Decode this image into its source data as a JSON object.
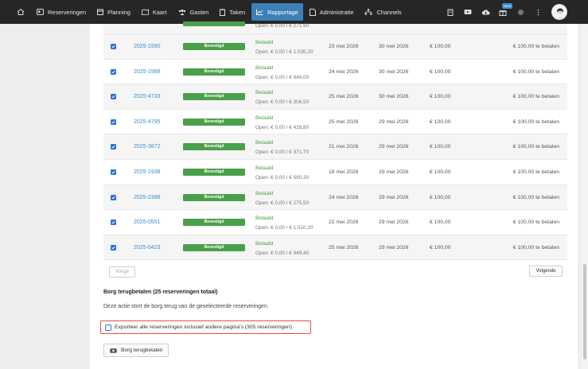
{
  "nav": {
    "items": [
      {
        "label": "Reserveringen",
        "icon": "calendar-card-icon"
      },
      {
        "label": "Planning",
        "icon": "calendar-icon"
      },
      {
        "label": "Kaart",
        "icon": "map-icon"
      },
      {
        "label": "Gasten",
        "icon": "users-icon"
      },
      {
        "label": "Taken",
        "icon": "clipboard-icon"
      },
      {
        "label": "Rapportage",
        "icon": "chart-icon",
        "active": true
      },
      {
        "label": "Administratie",
        "icon": "document-icon"
      },
      {
        "label": "Channels",
        "icon": "sitemap-icon"
      }
    ],
    "badge_new": "NEW"
  },
  "rows": [
    {
      "id": "2025-1990",
      "status": "Bevestigd",
      "payment": "Betaald",
      "open": "Open: € 0,00 / € 1.035,20",
      "arrival": "23 mei 2026",
      "departure": "30 mei 2026",
      "deposit": "€ 100,00",
      "due": "€ 100,00 te betalen"
    },
    {
      "id": "2025-1988",
      "status": "Bevestigd",
      "payment": "Betaald",
      "open": "Open: € 0,00 / € 946,00",
      "arrival": "24 mei 2026",
      "departure": "30 mei 2026",
      "deposit": "€ 100,00",
      "due": "€ 100,00 te betalen"
    },
    {
      "id": "2025-4733",
      "status": "Bevestigd",
      "payment": "Betaald",
      "open": "Open: € 0,00 / € 306,50",
      "arrival": "25 mei 2026",
      "departure": "30 mei 2026",
      "deposit": "€ 100,00",
      "due": "€ 100,00 te betalen"
    },
    {
      "id": "2025-4795",
      "status": "Bevestigd",
      "payment": "Betaald",
      "open": "Open: € 0,00 / € 428,80",
      "arrival": "25 mei 2026",
      "departure": "29 mei 2026",
      "deposit": "€ 100,00",
      "due": "€ 100,00 te betalen"
    },
    {
      "id": "2025-3872",
      "status": "Bevestigd",
      "payment": "Betaald",
      "open": "Open: € 0,00 / € 371,70",
      "arrival": "21 mei 2026",
      "departure": "29 mei 2026",
      "deposit": "€ 100,00",
      "due": "€ 100,00 te betalen"
    },
    {
      "id": "2025-1938",
      "status": "Bevestigd",
      "payment": "Betaald",
      "open": "Open: € 0,00 / € 560,30",
      "arrival": "18 mei 2026",
      "departure": "29 mei 2026",
      "deposit": "€ 100,00",
      "due": "€ 100,00 te betalen"
    },
    {
      "id": "2025-2388",
      "status": "Bevestigd",
      "payment": "Betaald",
      "open": "Open: € 0,00 / € 275,50",
      "arrival": "24 mei 2026",
      "departure": "29 mei 2026",
      "deposit": "€ 100,00",
      "due": "€ 100,00 te betalen"
    },
    {
      "id": "2025-0551",
      "status": "Bevestigd",
      "payment": "Betaald",
      "open": "Open: € 0,00 / € 1.510,20",
      "arrival": "22 mei 2026",
      "departure": "29 mei 2026",
      "deposit": "€ 100,00",
      "due": "€ 100,00 te betalen"
    },
    {
      "id": "2025-0423",
      "status": "Bevestigd",
      "payment": "Betaald",
      "open": "Open: € 0,00 / € 949,40",
      "arrival": "25 mei 2026",
      "departure": "29 mei 2026",
      "deposit": "€ 100,00",
      "due": "€ 100,00 te betalen"
    }
  ],
  "pagination": {
    "prev": "Vorige",
    "next": "Volgende"
  },
  "section": {
    "title": "Borg terugbetalen (25 reserveringen totaal)",
    "description": "Deze actie stort de borg terug van de geselecteerde reserveringen.",
    "export_label": "Exporteer alle reserveringen inclusief andere pagina's (305 reserveringen)",
    "refund_button": "Borg terugbetalen"
  },
  "partial_top_row": {
    "open": "Open: € 0,00 / € 271,90"
  },
  "colors": {
    "nav_bg": "#262626",
    "nav_active": "#3d7fb8",
    "confirmed": "#4aa04a",
    "link": "#3a8fc8",
    "highlight": "#e2503f"
  }
}
